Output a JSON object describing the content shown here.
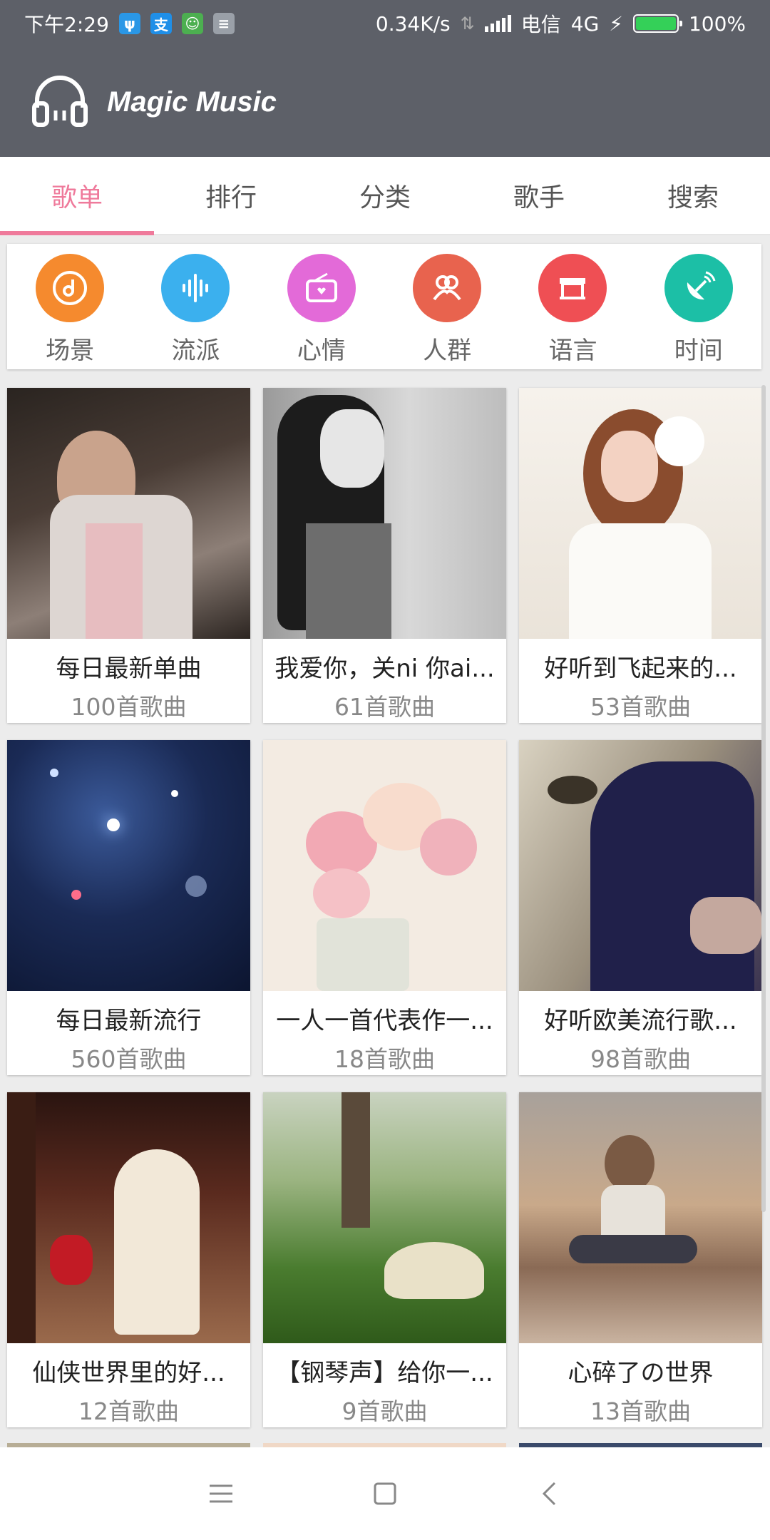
{
  "status": {
    "time": "下午2:29",
    "speed": "0.34K/s",
    "carrier": "电信",
    "network": "4G",
    "battery": "100%",
    "battery_level": 1.0,
    "notif_icons": [
      "usb-icon",
      "alipay-icon",
      "android-icon",
      "message-icon"
    ]
  },
  "app": {
    "title": "Magic Music",
    "logo_icon": "headphones-icon"
  },
  "tabs": [
    {
      "label": "歌单",
      "active": true
    },
    {
      "label": "排行"
    },
    {
      "label": "分类"
    },
    {
      "label": "歌手"
    },
    {
      "label": "搜索"
    }
  ],
  "categories": [
    {
      "label": "场景",
      "color": "#f58a2e",
      "icon": "music-disc-icon"
    },
    {
      "label": "流派",
      "color": "#3bb0ee",
      "icon": "soundwave-icon"
    },
    {
      "label": "心情",
      "color": "#e36ad8",
      "icon": "radio-heart-icon"
    },
    {
      "label": "人群",
      "color": "#e8634e",
      "icon": "people-icon"
    },
    {
      "label": "语言",
      "color": "#ef4f54",
      "icon": "storefront-icon"
    },
    {
      "label": "时间",
      "color": "#1cbfa6",
      "icon": "satellite-dish-icon"
    }
  ],
  "playlists": [
    {
      "name": "每日最新单曲",
      "count": "100首歌曲"
    },
    {
      "name": "我爱你，关ni 你ai...",
      "count": "61首歌曲"
    },
    {
      "name": "好听到飞起来的...",
      "count": "53首歌曲"
    },
    {
      "name": "每日最新流行",
      "count": "560首歌曲"
    },
    {
      "name": "一人一首代表作一...",
      "count": "18首歌曲"
    },
    {
      "name": "好听欧美流行歌...",
      "count": "98首歌曲"
    },
    {
      "name": "仙侠世界里的好...",
      "count": "12首歌曲"
    },
    {
      "name": "【钢琴声】给你一...",
      "count": "9首歌曲"
    },
    {
      "name": "心碎了の世界",
      "count": "13首歌曲"
    }
  ],
  "nav": [
    "menu-icon",
    "home-square-icon",
    "back-chevron-icon"
  ]
}
